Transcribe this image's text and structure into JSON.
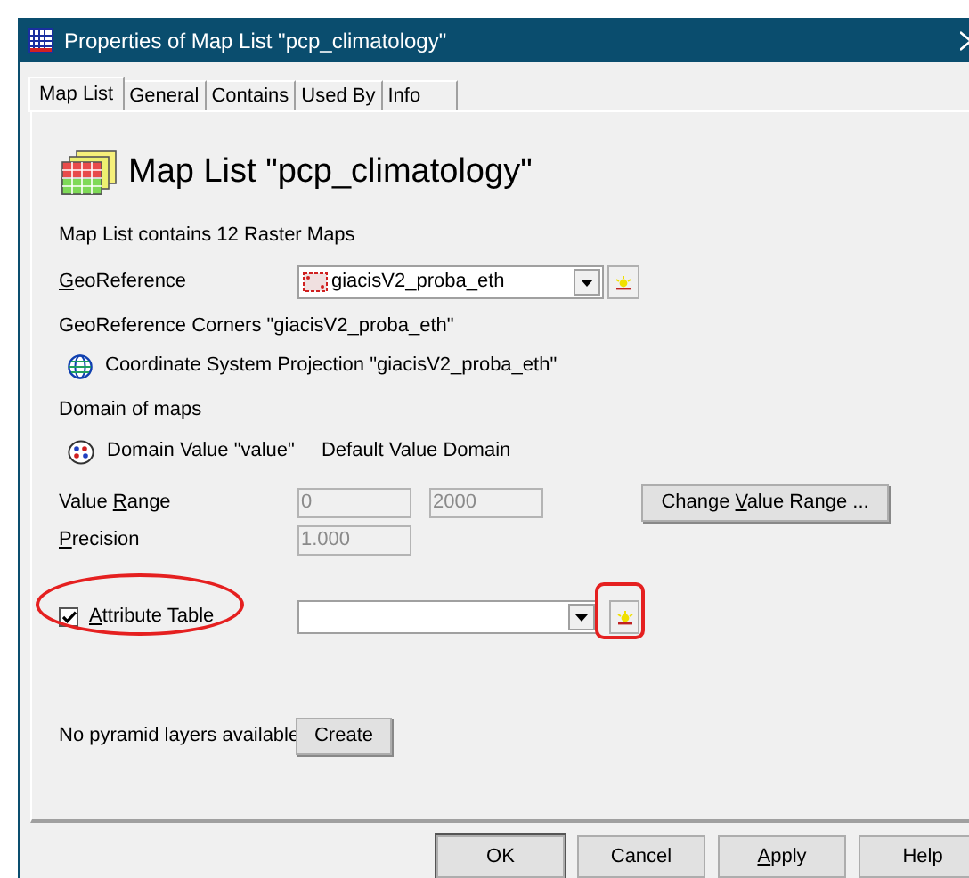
{
  "window": {
    "title": "Properties of Map List \"pcp_climatology\""
  },
  "tabs": [
    {
      "label": "Map List",
      "selected": true
    },
    {
      "label": "General",
      "selected": false
    },
    {
      "label": "Contains",
      "selected": false
    },
    {
      "label": "Used By",
      "selected": false
    },
    {
      "label": "Info",
      "selected": false
    }
  ],
  "heading": "Map List \"pcp_climatology\"",
  "summary": "Map List contains 12 Raster Maps",
  "georeference": {
    "label": {
      "key": "G",
      "post": "eoReference"
    },
    "value": "giacisV2_proba_eth"
  },
  "corners": "GeoReference Corners \"giacisV2_proba_eth\"",
  "coordinate_system": "Coordinate System Projection \"giacisV2_proba_eth\"",
  "domain_caption": "Domain of maps",
  "domain": {
    "name": "Domain Value \"value\"",
    "description": "Default Value Domain"
  },
  "value_range": {
    "label": {
      "pre": "Value ",
      "key": "R",
      "post": "ange"
    },
    "min": "0",
    "max": "2000",
    "disabled": true
  },
  "change_range_button": {
    "pre": "Change ",
    "key": "V",
    "post": "alue Range ..."
  },
  "precision": {
    "label": {
      "key": "P",
      "post": "recision"
    },
    "value": "1.000",
    "disabled": true
  },
  "attribute_table": {
    "label": {
      "key": "A",
      "post": "ttribute Table"
    },
    "checked": true
  },
  "pyramid": {
    "message": "No pyramid layers available",
    "button": "Create"
  },
  "buttons": [
    {
      "label": {
        "post": "OK"
      }
    },
    {
      "label": {
        "post": "Cancel"
      }
    },
    {
      "label": {
        "key": "A",
        "post": "pply"
      }
    },
    {
      "label": {
        "post": "Help"
      }
    }
  ]
}
